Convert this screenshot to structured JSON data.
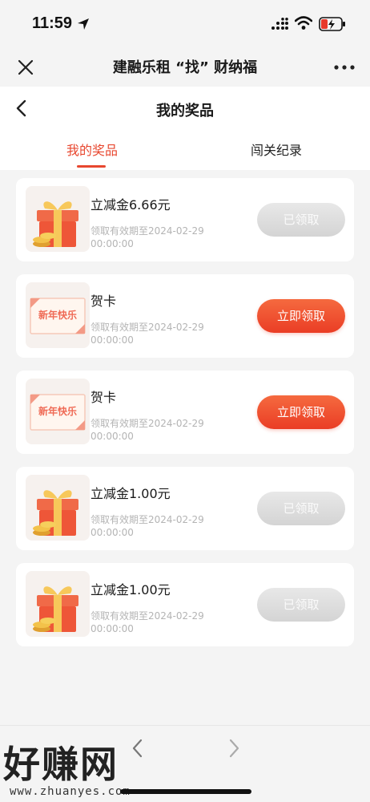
{
  "status_bar": {
    "time": "11:59"
  },
  "webview": {
    "title": "建融乐租 “找” 财纳福"
  },
  "header": {
    "title": "我的奖品",
    "tabs": [
      {
        "label": "我的奖品",
        "active": true
      },
      {
        "label": "闯关纪录",
        "active": false
      }
    ]
  },
  "prizes": [
    {
      "name": "立减金6.66元",
      "expiry": "领取有效期至2024-02-29 00:00:00",
      "button": "已领取",
      "status": "claimed",
      "icon": "gift-box-icon"
    },
    {
      "name": "贺卡",
      "expiry": "领取有效期至2024-02-29 00:00:00",
      "button": "立即领取",
      "status": "unclaimed",
      "icon": "greeting-card-icon",
      "card_text": "新年快乐"
    },
    {
      "name": "贺卡",
      "expiry": "领取有效期至2024-02-29 00:00:00",
      "button": "立即领取",
      "status": "unclaimed",
      "icon": "greeting-card-icon",
      "card_text": "新年快乐"
    },
    {
      "name": "立减金1.00元",
      "expiry": "领取有效期至2024-02-29 00:00:00",
      "button": "已领取",
      "status": "claimed",
      "icon": "gift-box-icon"
    },
    {
      "name": "立减金1.00元",
      "expiry": "领取有效期至2024-02-29 00:00:00",
      "button": "已领取",
      "status": "claimed",
      "icon": "gift-box-icon"
    }
  ],
  "watermark": {
    "title": "好赚网",
    "url": "www.zhuanyes.com"
  },
  "colors": {
    "accent": "#e8472f",
    "claimed_button": "#d9d9d9",
    "background": "#f4f4f4"
  }
}
